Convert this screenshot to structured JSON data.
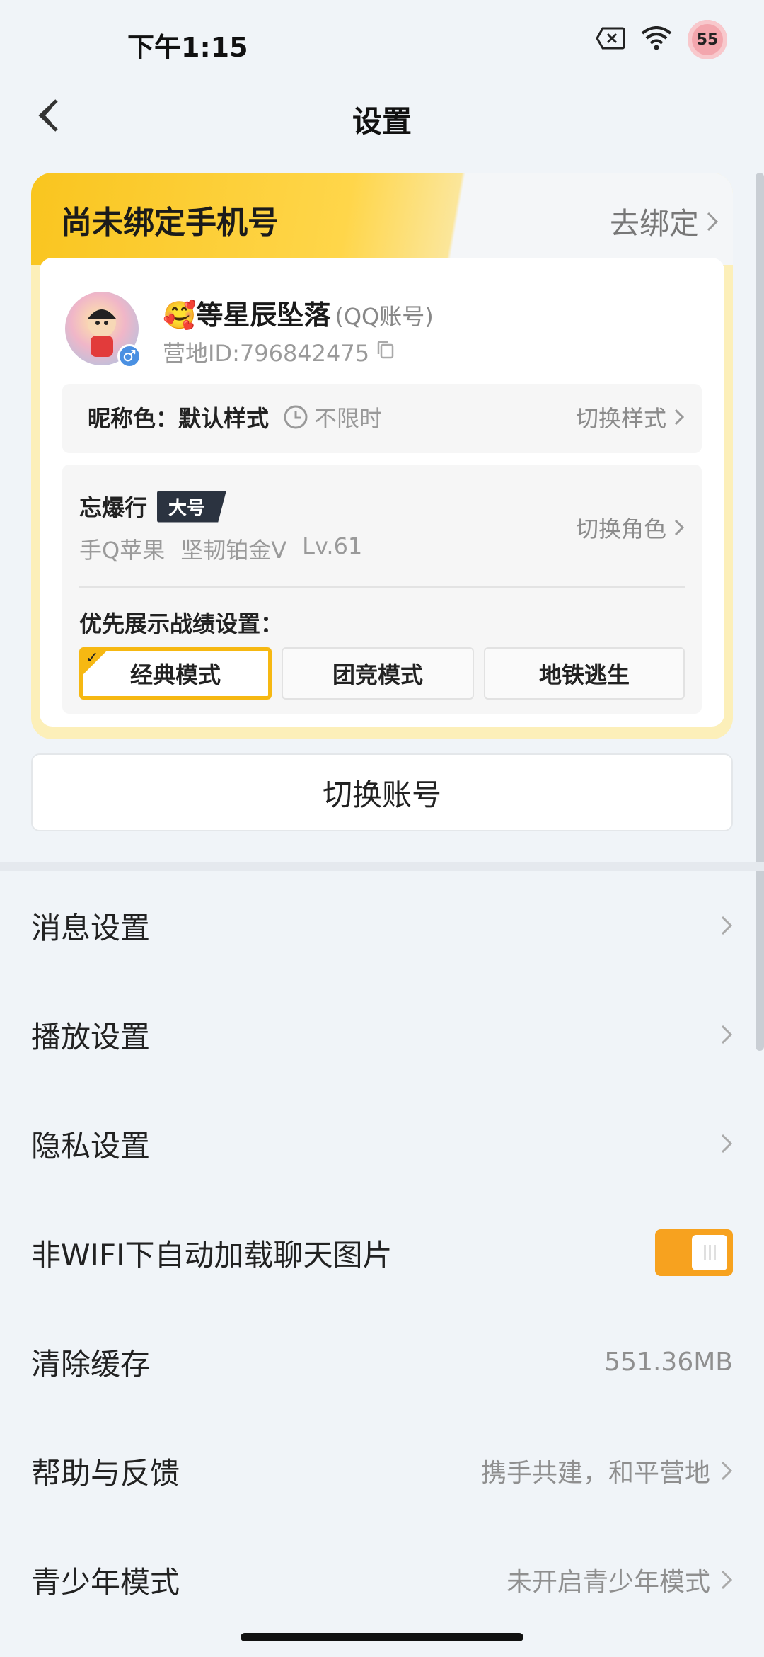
{
  "status_bar": {
    "time": "下午1:15",
    "battery": "55"
  },
  "header": {
    "title": "设置"
  },
  "bind_phone": {
    "label": "尚未绑定手机号",
    "action": "去绑定"
  },
  "profile": {
    "nickname": "🥰等星辰坠落",
    "account_type": "(QQ账号)",
    "camp_id": "营地ID:796842475",
    "gender": "♂",
    "nick_color_label": "昵称色：默认样式",
    "time_limit": "不限时",
    "switch_style": "切换样式"
  },
  "role": {
    "name": "忘爆行",
    "tag": "大号",
    "platform": "手Q苹果",
    "rank": "坚韧铂金V",
    "level": "Lv.61",
    "switch_role": "切换角色",
    "priority_label": "优先展示战绩设置：",
    "modes": [
      "经典模式",
      "团竞模式",
      "地铁逃生"
    ],
    "selected_mode": "经典模式"
  },
  "switch_account": "切换账号",
  "settings": {
    "message": "消息设置",
    "playback": "播放设置",
    "privacy": "隐私设置",
    "auto_load": "非WIFI下自动加载聊天图片",
    "auto_load_on": true,
    "clear_cache": "清除缓存",
    "cache_size": "551.36MB",
    "help": "帮助与反馈",
    "help_hint": "携手共建，和平营地",
    "teen": "青少年模式",
    "teen_hint": "未开启青少年模式"
  },
  "colors": {
    "accent": "#f6b812",
    "toggle_on": "#f7a21f"
  }
}
